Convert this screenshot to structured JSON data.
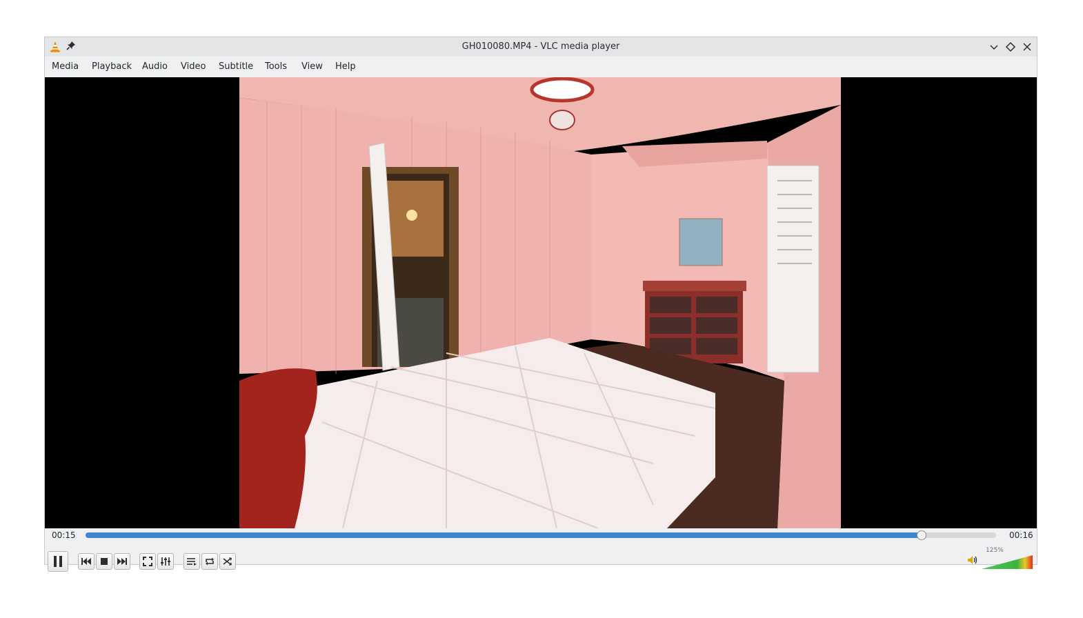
{
  "window": {
    "title": "GH010080.MP4 - VLC media player",
    "icons": [
      "vlc-cone-icon",
      "pin-icon",
      "minimize-icon",
      "maximize-icon",
      "close-icon"
    ]
  },
  "menu": [
    "Media",
    "Playback",
    "Audio",
    "Video",
    "Subtitle",
    "Tools",
    "View",
    "Help"
  ],
  "playback": {
    "elapsed": "00:15",
    "total": "00:16",
    "progress": 0.918
  },
  "volume": {
    "label": "125%",
    "level": 1.0
  },
  "controls": [
    "pause",
    "previous",
    "stop",
    "next",
    "fullscreen",
    "extended-settings",
    "playlist",
    "loop",
    "shuffle"
  ],
  "colors": {
    "accent": "#3c87cf",
    "video_bg": "#000000",
    "wall": "#e8a9a6"
  }
}
